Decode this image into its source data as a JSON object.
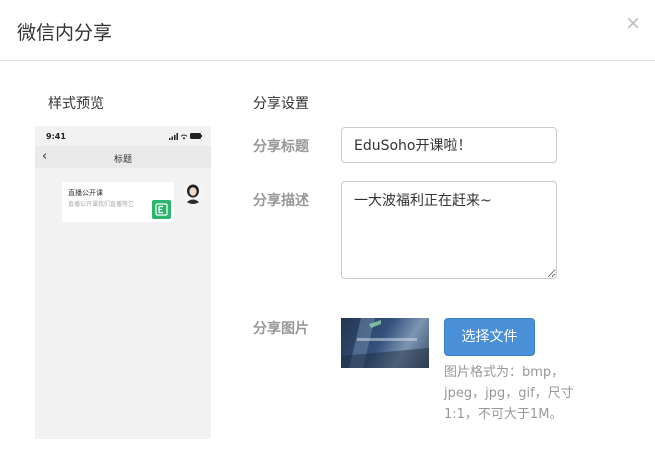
{
  "modal": {
    "title": "微信内分享",
    "close_glyph": "×"
  },
  "preview": {
    "label": "样式预览",
    "phone": {
      "time": "9:41",
      "nav_title": "标题",
      "back_glyph": "‹",
      "card_title": "直播公开课",
      "card_desc": "直播公开课我们直播等它"
    }
  },
  "settings": {
    "label": "分享设置",
    "title_label": "分享标题",
    "title_value": "EduSoho开课啦！",
    "desc_label": "分享描述",
    "desc_value": "一大波福利正在赶来~",
    "image_label": "分享图片",
    "select_button": "选择文件",
    "hint": "图片格式为：bmp，jpeg，jpg，gif，尺寸1:1，不可大于1M。"
  },
  "colors": {
    "primary_button": "#4a90d9",
    "thumb_green": "#2ab56a"
  }
}
